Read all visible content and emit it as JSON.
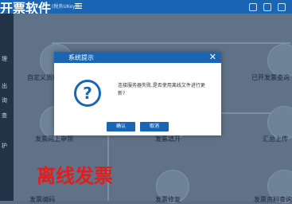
{
  "app": {
    "title": "开票软件",
    "edition": "(税务UKey版)"
  },
  "sidebar": {
    "items": [
      "理",
      "出",
      "询",
      "查",
      "护"
    ]
  },
  "main": {
    "nodes": [
      {
        "label": "自定义货物编码",
        "icon": "config-icon"
      },
      {
        "label": "已开发票查询",
        "icon": "check-list-icon"
      },
      {
        "label": "发票网上申领",
        "icon": "apply-icon"
      },
      {
        "label": "发票填开",
        "icon": "fill-icon"
      },
      {
        "label": "汇总上传",
        "icon": "upload-icon"
      },
      {
        "label": "发票编码",
        "icon": "code-icon"
      },
      {
        "label": "发票修复",
        "icon": "repair-icon"
      },
      {
        "label": "发票资料查询",
        "icon": "search-icon"
      }
    ]
  },
  "dialog": {
    "title": "系统提示",
    "message": "连接服务器失败,是否使用离线文件进行更新?",
    "confirm_label": "确认",
    "cancel_label": "取消"
  },
  "overlay": {
    "caption": "离线发票",
    "caption_color": "#e21d1d"
  },
  "colors": {
    "header_blue": "#1b66b4"
  }
}
